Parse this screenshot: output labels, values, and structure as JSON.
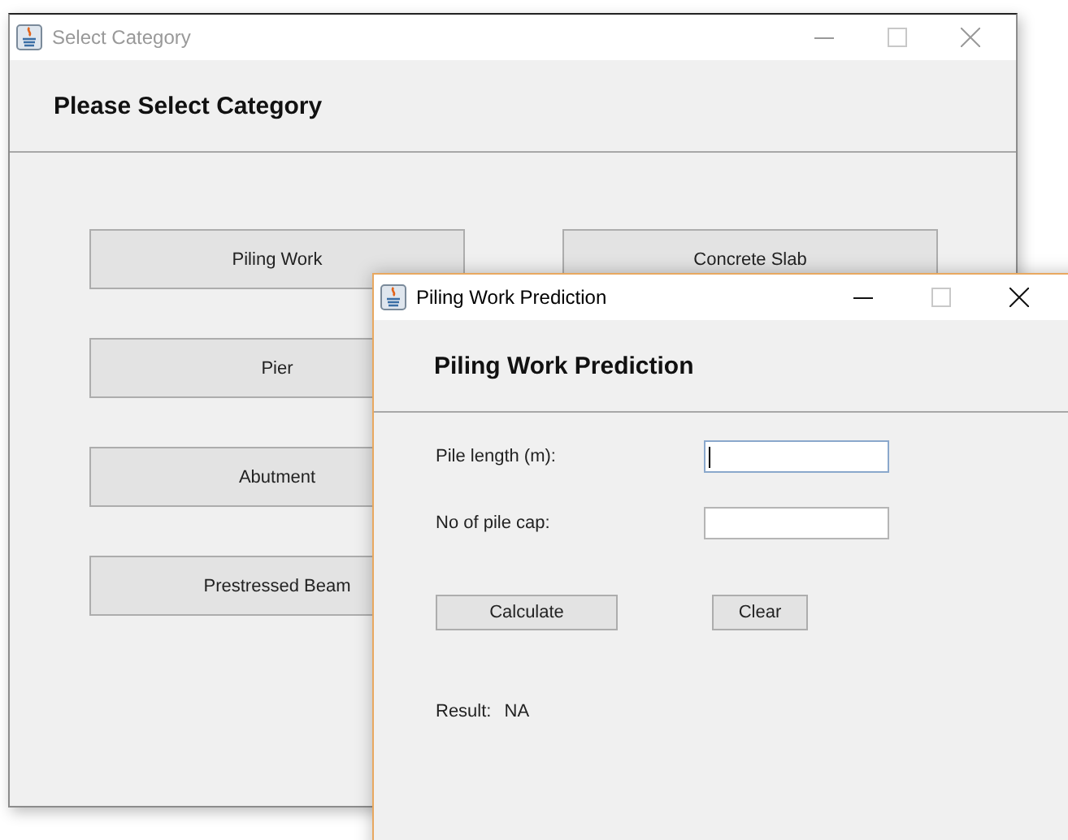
{
  "windows": [
    {
      "kind": "category",
      "title": "Select Category",
      "active": false,
      "heading": "Please Select Category",
      "left_column": [
        "Piling Work",
        "Pier",
        "Abutment",
        "Prestressed Beam"
      ],
      "right_column": [
        "Concrete Slab"
      ]
    },
    {
      "kind": "prediction",
      "title": "Piling Work Prediction",
      "active": true,
      "heading": "Piling Work Prediction",
      "fields": [
        {
          "label": "Pile length (m):",
          "focused": true
        },
        {
          "label": "No of pile cap:",
          "focused": false
        }
      ],
      "buttons": [
        "Calculate",
        "Clear"
      ],
      "result_label": "Result:",
      "result_value": "NA"
    }
  ]
}
